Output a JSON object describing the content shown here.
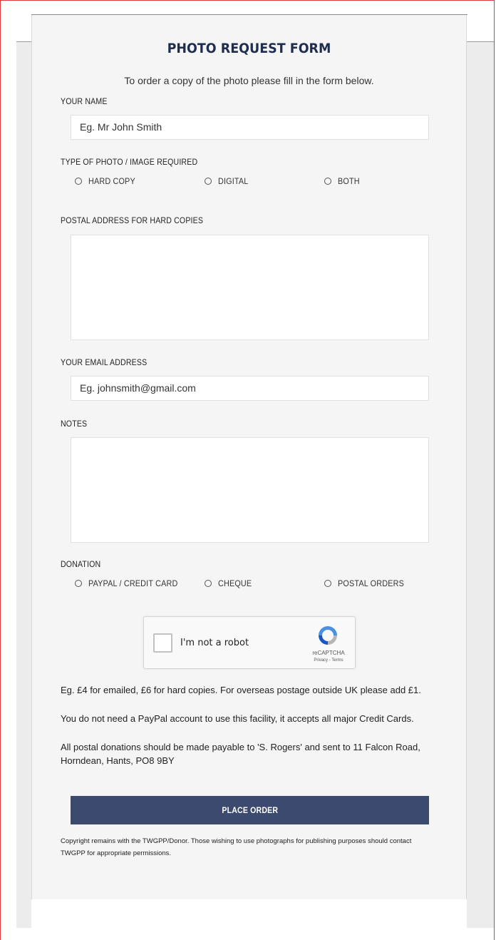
{
  "form": {
    "title": "PHOTO REQUEST FORM",
    "intro": "To order a copy of the photo please fill in the form below.",
    "name_label": "YOUR NAME",
    "name_placeholder": "Eg. Mr John Smith",
    "photo_type_label": "TYPE OF PHOTO / IMAGE REQUIRED",
    "photo_types": [
      "HARD COPY",
      "DIGITAL",
      "BOTH"
    ],
    "postal_label": "POSTAL ADDRESS FOR HARD COPIES",
    "email_label": "YOUR EMAIL ADDRESS",
    "email_placeholder": "Eg. johnsmith@gmail.com",
    "notes_label": "NOTES",
    "donation_label": "DONATION",
    "donation_types": [
      "PAYPAL / CREDIT CARD",
      "CHEQUE",
      "POSTAL ORDERS"
    ],
    "captcha": {
      "label": "I'm not a robot",
      "brand": "reCAPTCHA",
      "terms": "Privacy - Terms"
    },
    "info_1": "Eg. £4 for emailed, £6 for hard copies. For overseas postage outside UK please add £1.",
    "info_2": "You do not need a PayPal account to use this facility, it accepts all major Credit Cards.",
    "info_3": "All postal donations should be made payable to 'S. Rogers' and sent to 11 Falcon Road, Horndean, Hants, PO8 9BY",
    "submit_label": "PLACE ORDER",
    "copyright": "Copyright remains with the TWGPP/Donor. Those wishing to use photographs for publishing purposes should contact TWGPP for appropriate permissions."
  },
  "colors": {
    "title": "#1f2d4f",
    "button": "#3d4a70",
    "frame": "#e23a3a"
  }
}
